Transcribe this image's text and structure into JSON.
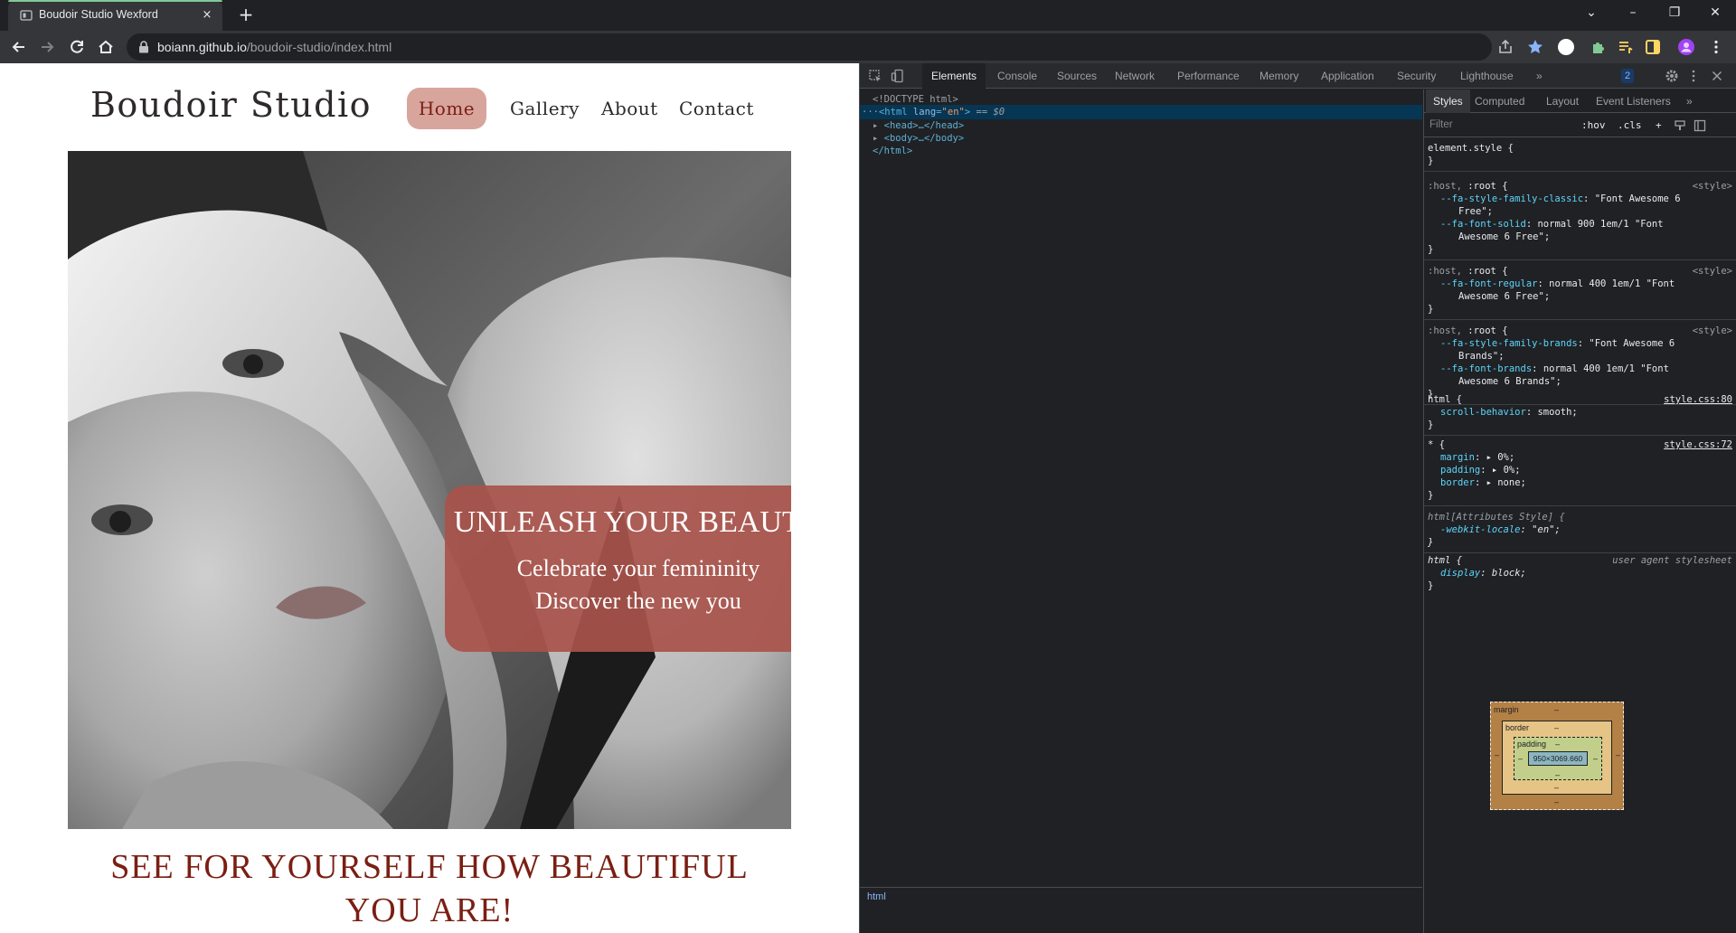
{
  "browser": {
    "tab_title": "Boudoir Studio Wexford",
    "new_tab_symbol": "+",
    "close_symbol": "×",
    "url_host": "boiann.github.io",
    "url_path": "/boudoir-studio/index.html",
    "window_controls": {
      "minimize": "–",
      "maximize": "❐",
      "close": "✕",
      "tab_search": "⌄"
    }
  },
  "site": {
    "logo": "Boudoir Studio",
    "nav": {
      "home": "Home",
      "gallery": "Gallery",
      "about": "About",
      "contact": "Contact"
    },
    "hero": {
      "heading": "UNLEASH YOUR BEAUTY",
      "sub1": "Celebrate your femininity",
      "sub2": "Discover the new you"
    },
    "tagline": "SEE FOR YOURSELF HOW BEAUTIFUL YOU ARE!"
  },
  "devtools": {
    "tabs": [
      "Elements",
      "Console",
      "Sources",
      "Network",
      "Performance",
      "Memory",
      "Application",
      "Security",
      "Lighthouse"
    ],
    "more_tabs": "»",
    "issues_count": "2",
    "dom": {
      "doctype": "<!DOCTYPE html>",
      "html_open_tag": "html",
      "html_attr_name": "lang",
      "html_attr_value": "\"en\"",
      "selected_marker": "== $0",
      "head": "<head>…</head>",
      "body": "<body>…</body>",
      "html_close": "</html>"
    },
    "breadcrumb": "html",
    "styles_tabs": [
      "Styles",
      "Computed",
      "Layout",
      "Event Listeners"
    ],
    "filter_placeholder": "Filter",
    "hov": ":hov",
    "cls": ".cls",
    "plus": "+",
    "rules": {
      "element_style": "element.style {",
      "close": "}",
      "root1_sel_dim": ":host, ",
      "root_sel": ":root {",
      "style_src": "<style>",
      "root1_p1_name": "--fa-style-family-classic",
      "root1_p1_val": "\"Font Awesome 6",
      "root1_p1_cont": "Free\";",
      "root1_p2_name": "--fa-font-solid",
      "root1_p2_val": "normal 900 1em/1 \"Font",
      "root1_p2_cont": "Awesome 6 Free\";",
      "root2_p1_name": "--fa-font-regular",
      "root2_p1_val": "normal 400 1em/1 \"Font",
      "root2_p1_cont": "Awesome 6 Free\";",
      "root3_p1_name": "--fa-style-family-brands",
      "root3_p1_val": "\"Font Awesome 6",
      "root3_p1_cont": "Brands\";",
      "root3_p2_name": "--fa-font-brands",
      "root3_p2_val": "normal 400 1em/1 \"Font",
      "root3_p2_cont": "Awesome 6 Brands\";",
      "html_sel": "html {",
      "html_src": "style.css:80",
      "html_p_name": "scroll-behavior",
      "html_p_val": "smooth;",
      "star_sel": "* {",
      "star_src": "style.css:72",
      "star_p1_name": "margin",
      "star_p1_val": "▸ 0%;",
      "star_p2_name": "padding",
      "star_p2_val": "▸ 0%;",
      "star_p3_name": "border",
      "star_p3_val": "▸ none;",
      "attr_sel": "html[Attributes Style] {",
      "attr_p_name": "-webkit-locale",
      "attr_p_val": "\"en\";",
      "ua_sel": "html {",
      "ua_src": "user agent stylesheet",
      "ua_p_name": "display",
      "ua_p_val": "block;"
    },
    "boxmodel": {
      "margin_label": "margin",
      "border_label": "border",
      "padding_label": "padding",
      "content_size": "950×3069.660",
      "dash": "–"
    }
  }
}
